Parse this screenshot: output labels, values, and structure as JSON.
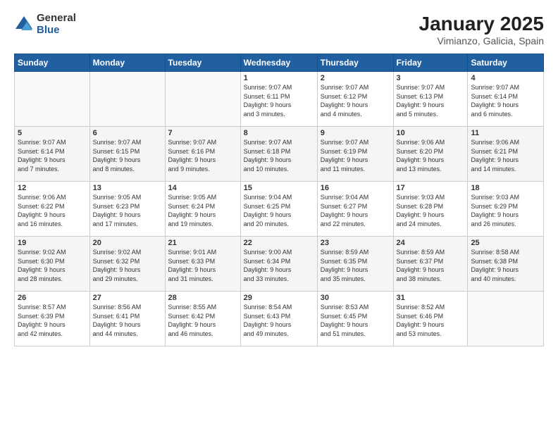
{
  "logo": {
    "general": "General",
    "blue": "Blue"
  },
  "header": {
    "title": "January 2025",
    "subtitle": "Vimianzo, Galicia, Spain"
  },
  "weekdays": [
    "Sunday",
    "Monday",
    "Tuesday",
    "Wednesday",
    "Thursday",
    "Friday",
    "Saturday"
  ],
  "weeks": [
    [
      {
        "day": "",
        "info": ""
      },
      {
        "day": "",
        "info": ""
      },
      {
        "day": "",
        "info": ""
      },
      {
        "day": "1",
        "info": "Sunrise: 9:07 AM\nSunset: 6:11 PM\nDaylight: 9 hours\nand 3 minutes."
      },
      {
        "day": "2",
        "info": "Sunrise: 9:07 AM\nSunset: 6:12 PM\nDaylight: 9 hours\nand 4 minutes."
      },
      {
        "day": "3",
        "info": "Sunrise: 9:07 AM\nSunset: 6:13 PM\nDaylight: 9 hours\nand 5 minutes."
      },
      {
        "day": "4",
        "info": "Sunrise: 9:07 AM\nSunset: 6:14 PM\nDaylight: 9 hours\nand 6 minutes."
      }
    ],
    [
      {
        "day": "5",
        "info": "Sunrise: 9:07 AM\nSunset: 6:14 PM\nDaylight: 9 hours\nand 7 minutes."
      },
      {
        "day": "6",
        "info": "Sunrise: 9:07 AM\nSunset: 6:15 PM\nDaylight: 9 hours\nand 8 minutes."
      },
      {
        "day": "7",
        "info": "Sunrise: 9:07 AM\nSunset: 6:16 PM\nDaylight: 9 hours\nand 9 minutes."
      },
      {
        "day": "8",
        "info": "Sunrise: 9:07 AM\nSunset: 6:18 PM\nDaylight: 9 hours\nand 10 minutes."
      },
      {
        "day": "9",
        "info": "Sunrise: 9:07 AM\nSunset: 6:19 PM\nDaylight: 9 hours\nand 11 minutes."
      },
      {
        "day": "10",
        "info": "Sunrise: 9:06 AM\nSunset: 6:20 PM\nDaylight: 9 hours\nand 13 minutes."
      },
      {
        "day": "11",
        "info": "Sunrise: 9:06 AM\nSunset: 6:21 PM\nDaylight: 9 hours\nand 14 minutes."
      }
    ],
    [
      {
        "day": "12",
        "info": "Sunrise: 9:06 AM\nSunset: 6:22 PM\nDaylight: 9 hours\nand 16 minutes."
      },
      {
        "day": "13",
        "info": "Sunrise: 9:05 AM\nSunset: 6:23 PM\nDaylight: 9 hours\nand 17 minutes."
      },
      {
        "day": "14",
        "info": "Sunrise: 9:05 AM\nSunset: 6:24 PM\nDaylight: 9 hours\nand 19 minutes."
      },
      {
        "day": "15",
        "info": "Sunrise: 9:04 AM\nSunset: 6:25 PM\nDaylight: 9 hours\nand 20 minutes."
      },
      {
        "day": "16",
        "info": "Sunrise: 9:04 AM\nSunset: 6:27 PM\nDaylight: 9 hours\nand 22 minutes."
      },
      {
        "day": "17",
        "info": "Sunrise: 9:03 AM\nSunset: 6:28 PM\nDaylight: 9 hours\nand 24 minutes."
      },
      {
        "day": "18",
        "info": "Sunrise: 9:03 AM\nSunset: 6:29 PM\nDaylight: 9 hours\nand 26 minutes."
      }
    ],
    [
      {
        "day": "19",
        "info": "Sunrise: 9:02 AM\nSunset: 6:30 PM\nDaylight: 9 hours\nand 28 minutes."
      },
      {
        "day": "20",
        "info": "Sunrise: 9:02 AM\nSunset: 6:32 PM\nDaylight: 9 hours\nand 29 minutes."
      },
      {
        "day": "21",
        "info": "Sunrise: 9:01 AM\nSunset: 6:33 PM\nDaylight: 9 hours\nand 31 minutes."
      },
      {
        "day": "22",
        "info": "Sunrise: 9:00 AM\nSunset: 6:34 PM\nDaylight: 9 hours\nand 33 minutes."
      },
      {
        "day": "23",
        "info": "Sunrise: 8:59 AM\nSunset: 6:35 PM\nDaylight: 9 hours\nand 35 minutes."
      },
      {
        "day": "24",
        "info": "Sunrise: 8:59 AM\nSunset: 6:37 PM\nDaylight: 9 hours\nand 38 minutes."
      },
      {
        "day": "25",
        "info": "Sunrise: 8:58 AM\nSunset: 6:38 PM\nDaylight: 9 hours\nand 40 minutes."
      }
    ],
    [
      {
        "day": "26",
        "info": "Sunrise: 8:57 AM\nSunset: 6:39 PM\nDaylight: 9 hours\nand 42 minutes."
      },
      {
        "day": "27",
        "info": "Sunrise: 8:56 AM\nSunset: 6:41 PM\nDaylight: 9 hours\nand 44 minutes."
      },
      {
        "day": "28",
        "info": "Sunrise: 8:55 AM\nSunset: 6:42 PM\nDaylight: 9 hours\nand 46 minutes."
      },
      {
        "day": "29",
        "info": "Sunrise: 8:54 AM\nSunset: 6:43 PM\nDaylight: 9 hours\nand 49 minutes."
      },
      {
        "day": "30",
        "info": "Sunrise: 8:53 AM\nSunset: 6:45 PM\nDaylight: 9 hours\nand 51 minutes."
      },
      {
        "day": "31",
        "info": "Sunrise: 8:52 AM\nSunset: 6:46 PM\nDaylight: 9 hours\nand 53 minutes."
      },
      {
        "day": "",
        "info": ""
      }
    ]
  ]
}
